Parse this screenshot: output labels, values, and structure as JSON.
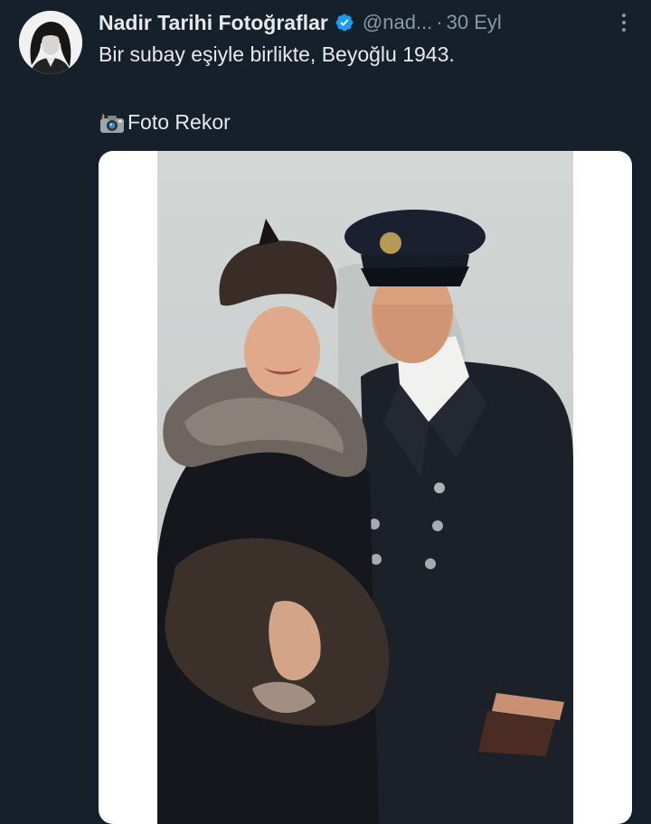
{
  "tweet": {
    "display_name": "Nadir Tarihi Fotoğraflar",
    "handle": "@nad...",
    "separator": "·",
    "time": "30 Eyl",
    "text_line1": "Bir subay eşiyle birlikte, Beyoğlu 1943.",
    "credit": "Foto Rekor"
  },
  "icons": {
    "verified": "verified-badge-icon",
    "more": "more-options-icon",
    "camera": "camera-flash-icon"
  },
  "colors": {
    "background": "#15202b",
    "text": "#e7e9ea",
    "muted": "#8b98a5",
    "verified": "#1d9bf0"
  }
}
